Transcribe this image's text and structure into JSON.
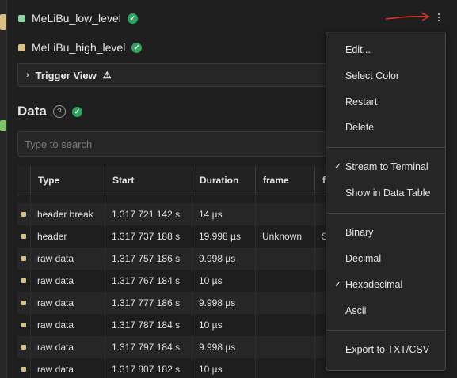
{
  "channels": [
    {
      "name": "MeLiBu_low_level",
      "color": "#8fd19e"
    },
    {
      "name": "MeLiBu_high_level",
      "color": "#d9c089"
    }
  ],
  "trigger_view": {
    "label": "Trigger View",
    "warning_icon": "⚠"
  },
  "data_section": {
    "title": "Data",
    "help_icon": "?"
  },
  "search": {
    "placeholder": "Type to search"
  },
  "table": {
    "columns": [
      "Type",
      "Start",
      "Duration",
      "frame",
      "f"
    ],
    "rows": [
      {
        "type": "header break",
        "start": "1.317 721 142 s",
        "duration": "14 µs",
        "frame": "",
        "extra": ""
      },
      {
        "type": "header",
        "start": "1.317 737 188 s",
        "duration": "19.998 µs",
        "frame": "Unknown",
        "extra": "S"
      },
      {
        "type": "raw data",
        "start": "1.317 757 186 s",
        "duration": "9.998 µs",
        "frame": "",
        "extra": ""
      },
      {
        "type": "raw data",
        "start": "1.317 767 184 s",
        "duration": "10 µs",
        "frame": "",
        "extra": ""
      },
      {
        "type": "raw data",
        "start": "1.317 777 186 s",
        "duration": "9.998 µs",
        "frame": "",
        "extra": ""
      },
      {
        "type": "raw data",
        "start": "1.317 787 184 s",
        "duration": "10 µs",
        "frame": "",
        "extra": ""
      },
      {
        "type": "raw data",
        "start": "1.317 797 184 s",
        "duration": "9.998 µs",
        "frame": "",
        "extra": ""
      },
      {
        "type": "raw data",
        "start": "1.317 807 182 s",
        "duration": "10 µs",
        "frame": "",
        "extra": ""
      }
    ]
  },
  "menu": {
    "groups": [
      [
        {
          "label": "Edit...",
          "checked": false
        },
        {
          "label": "Select Color",
          "checked": false
        },
        {
          "label": "Restart",
          "checked": false
        },
        {
          "label": "Delete",
          "checked": false
        }
      ],
      [
        {
          "label": "Stream to Terminal",
          "checked": true
        },
        {
          "label": "Show in Data Table",
          "checked": false
        }
      ],
      [
        {
          "label": "Binary",
          "checked": false
        },
        {
          "label": "Decimal",
          "checked": false
        },
        {
          "label": "Hexadecimal",
          "checked": true
        },
        {
          "label": "Ascii",
          "checked": false
        }
      ],
      [
        {
          "label": "Export to TXT/CSV",
          "checked": false
        }
      ]
    ]
  },
  "icons": {
    "check": "✓",
    "chevron": "›",
    "tick": "✓"
  },
  "colors": {
    "accent_green": "#2fa360",
    "annotation_arrow": "#e03030"
  }
}
